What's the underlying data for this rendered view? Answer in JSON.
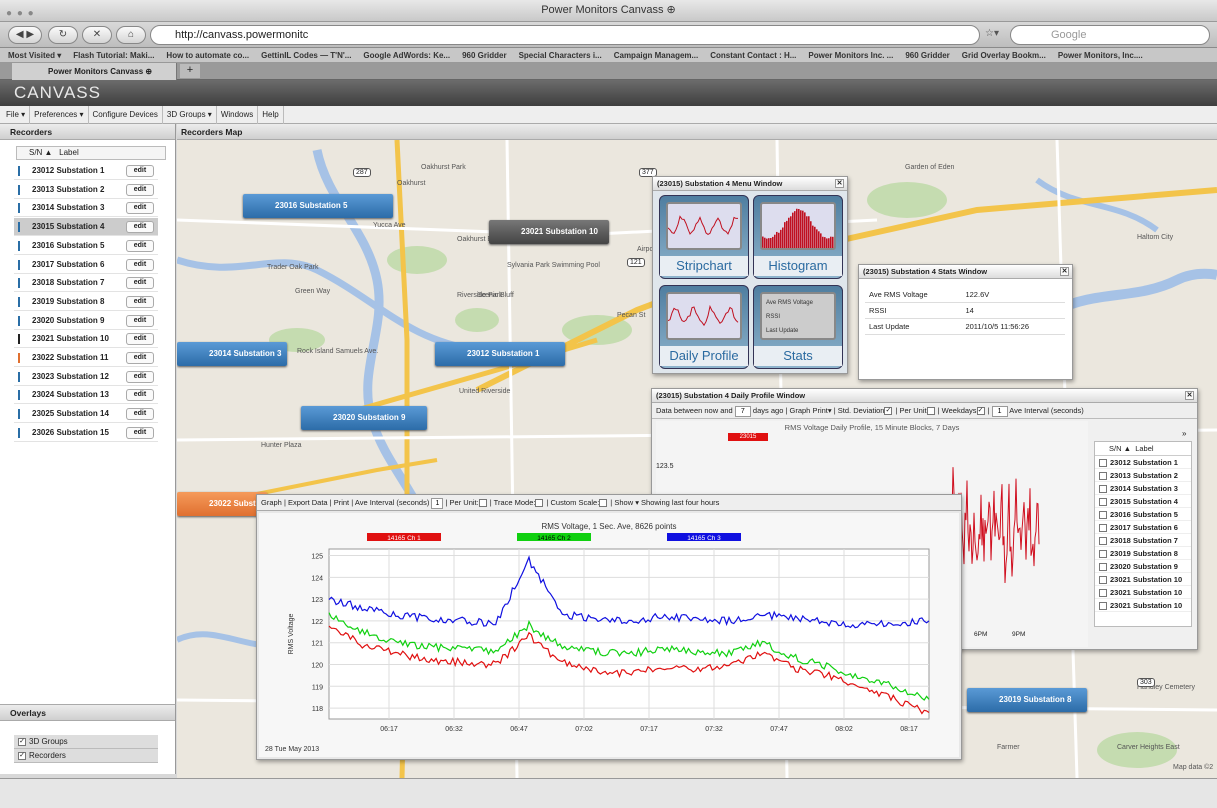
{
  "browser": {
    "window_title": "Power Monitors Canvass ⊕",
    "url": "http://canvass.powermonitc",
    "search_placeholder": "Google",
    "bookmarks": [
      "Most Visited ▾",
      "Flash Tutorial: Maki...",
      "How to automate co...",
      "GettinIL Codes — T'N'...",
      "Google AdWords: Ke...",
      "960 Gridder",
      "Special Characters i...",
      "Campaign Managem...",
      "Constant Contact : H...",
      "Power Monitors Inc. ...",
      "960 Gridder",
      "Grid Overlay Bookm...",
      "Power Monitors, Inc...."
    ],
    "tab_label": "Power Monitors Canvass ⊕",
    "tab_add": "+"
  },
  "app": {
    "logo": "CANVASS",
    "menu": [
      "File ▾",
      "Preferences ▾",
      "Configure Devices",
      "3D Groups ▾",
      "Windows",
      "Help"
    ]
  },
  "recorders": {
    "title": "Recorders",
    "col_sn": "S/N ▲",
    "col_label": "Label",
    "edit_label": "edit",
    "selected_index": 3,
    "items": [
      "23012 Substation 1",
      "23013 Substation 2",
      "23014 Substation 3",
      "23015 Substation 4",
      "23016 Substation 5",
      "23017 Substation 6",
      "23018 Substation 7",
      "23019 Substation 8",
      "23020 Substation 9",
      "23021 Substation 10",
      "23022 Substation 11",
      "23023 Substation 12",
      "23024 Substation 13",
      "23025 Substation 14",
      "23026 Substation 15"
    ]
  },
  "overlays": {
    "title": "Overlays",
    "items": [
      {
        "label": "3D Groups",
        "checked": true
      },
      {
        "label": "Recorders",
        "checked": true
      }
    ]
  },
  "map": {
    "title": "Recorders Map",
    "markers": [
      {
        "label": "23016 Substation 5",
        "style": "blue"
      },
      {
        "label": "23021 Substation 10",
        "style": "dark"
      },
      {
        "label": "23014 Substation 3",
        "style": "blue"
      },
      {
        "label": "23012 Substation 1",
        "style": "blue"
      },
      {
        "label": "23020 Substation 9",
        "style": "blue"
      },
      {
        "label": "23022 Substation",
        "style": "orange"
      },
      {
        "label": "23019 Substation 8",
        "style": "blue"
      }
    ],
    "places": [
      "Oakhurst Park",
      "Oakhurst",
      "Yucca Ave",
      "Oakhurst Elementary School",
      "Sylvania Park Swimming Pool",
      "Trader Oak Park",
      "Green Way",
      "Riverside Park",
      "Scenic Bluff",
      "Rock Island Samuels Ave.",
      "United Riverside",
      "Garden of Eden",
      "Haltom City",
      "Hunter Plaza",
      "Farmer",
      "Carver Heights East",
      "Handley Cemetery",
      "Airport Fwy",
      "Pecan St",
      "Map data ©2"
    ],
    "highways": [
      "377",
      "287",
      "121",
      "180",
      "303"
    ]
  },
  "menu_window": {
    "title": "(23015) Substation 4 Menu Window",
    "tiles": [
      "Stripchart",
      "Histogram",
      "Daily Profile",
      "Stats"
    ],
    "stats_tile_lines": [
      "Ave RMS Voltage",
      "RSSI",
      "Last Update"
    ]
  },
  "stats_window": {
    "title": "(23015) Substation 4 Stats Window",
    "rows": [
      {
        "label": "Ave RMS Voltage",
        "value": "122.6V"
      },
      {
        "label": "RSSI",
        "value": "14"
      },
      {
        "label": "Last Update",
        "value": "2011/10/5 11:56:26"
      }
    ]
  },
  "daily_profile": {
    "title": "(23015) Substation 4 Daily Profile Window",
    "toolbar": {
      "data_between": "Data between now and",
      "days_value": "7",
      "days_ago": "days ago",
      "graph": "Graph",
      "print": "Print▾",
      "std_dev": "Std. Deviation",
      "per_unit": "Per Unit",
      "weekdays": "Weekdays",
      "ave_value": "1",
      "ave_interval": "Ave Interval (seconds)"
    },
    "chart_title": "RMS Voltage Daily Profile, 15 Minute Blocks, 7 Days",
    "legend_chip": "23015",
    "y_tick": "123.5",
    "x_ticks": [
      "6PM",
      "9PM"
    ],
    "list_col_sn": "S/N ▲",
    "list_col_label": "Label",
    "list_items": [
      "23012 Substation 1",
      "23013 Substation 2",
      "23014 Substation 3",
      "23015 Substation 4",
      "23016 Substation 5",
      "23017 Substation 6",
      "23018 Substation 7",
      "23019 Substation 8",
      "23020 Substation 9",
      "23021 Substation 10",
      "23021 Substation 10",
      "23021 Substation 10"
    ]
  },
  "rms_window": {
    "toolbar": {
      "graph": "Graph",
      "export": "Export Data",
      "print": "Print",
      "ave_interval": "Ave Interval (seconds)",
      "ave_value": "1",
      "per_unit": "Per Unit:",
      "trace_mode": "Trace Mode:",
      "custom_scale": "Custom Scale:",
      "show": "Show ▾",
      "showing": "Showing last four hours"
    },
    "date": "28 Tue May 2013"
  },
  "chart_data": {
    "type": "line",
    "title": "RMS Voltage, 1 Sec. Ave, 8626 points",
    "ylabel": "RMS Voltage",
    "xlabel": "",
    "ylim": [
      117.5,
      125.3
    ],
    "yticks": [
      118,
      119,
      120,
      121,
      122,
      123,
      124,
      125
    ],
    "xtick_labels": [
      "06:17",
      "06:32",
      "06:47",
      "07:02",
      "07:17",
      "07:32",
      "07:47",
      "08:02",
      "08:17"
    ],
    "x_minutes": [
      0,
      15,
      30,
      45,
      60,
      75,
      90,
      105,
      120,
      135,
      150
    ],
    "series": [
      {
        "name": "14165 Ch 1",
        "color": "#e01010",
        "values": [
          121.8,
          120.9,
          120.5,
          120.2,
          120.1,
          120.0,
          121.3,
          120.1,
          119.7,
          119.6,
          119.9,
          119.8,
          120.0,
          120.5,
          119.8,
          119.5,
          118.9,
          118.4,
          117.8
        ]
      },
      {
        "name": "14165 Ch 2",
        "color": "#10d010",
        "values": [
          122.3,
          121.5,
          121.0,
          120.8,
          120.7,
          120.6,
          121.8,
          120.8,
          120.6,
          120.5,
          120.7,
          120.6,
          120.5,
          121.0,
          120.3,
          119.9,
          119.3,
          119.0,
          118.4
        ]
      },
      {
        "name": "14165 Ch 3",
        "color": "#1010e0",
        "values": [
          123.0,
          122.6,
          122.3,
          122.1,
          122.0,
          121.9,
          124.8,
          122.3,
          122.1,
          122.0,
          122.2,
          122.1,
          122.0,
          122.3,
          122.1,
          121.9,
          121.8,
          121.9,
          122.0
        ]
      }
    ]
  }
}
